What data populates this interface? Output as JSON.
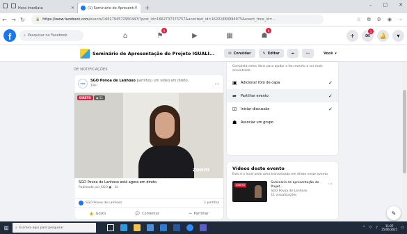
{
  "browser": {
    "tabs": [
      {
        "title": "Hora imediata"
      },
      {
        "title": "(1) Seminário de Apresentação"
      }
    ],
    "url_host": "https://www.facebook.com",
    "url_path": "/events/1661794572950447/?post_id=1662737373757&acontext_id=16201880994975&event_time_id=..."
  },
  "fb": {
    "search_placeholder": "Pesquisar no Facebook",
    "nav_badges": {
      "groups": "9",
      "marketplace": "9"
    },
    "right_badge": "1"
  },
  "page_header": {
    "title": "Seminário de Apresentação do Projeto IGUALI...",
    "buttons": {
      "share": "Convidar",
      "edit": "Editar"
    },
    "select_label": "Você"
  },
  "notifications": {
    "heading": "DE NOTIFICAÇÕES",
    "post": {
      "avatar_text": "SGO",
      "author": "SGO Povoa de Lanhoso",
      "action": "partilhou um vídeo em direto.",
      "time": "19h ·",
      "live_label": "DIRETO",
      "viewers": "11",
      "video_brand": "zoom",
      "body_line1": "SGO Povoa de Lanhoso está agora em direto.",
      "body_line2": "Publicado por SGO ● · 1h ·",
      "reactions": "SGO Povoa de Lanhoso",
      "shares": "1 partilha",
      "actions": {
        "like": "Gosto",
        "comment": "Comentar",
        "share": "Partilhar"
      }
    }
  },
  "checklist": {
    "intro": "Completa estes itens para ajudar o teu evento a ser mais encontrado.",
    "items": [
      {
        "label": "Adicionar foto de capa",
        "done": "✓"
      },
      {
        "label": "Partilhar evento",
        "done": "✓"
      },
      {
        "label": "Iniciar discussão",
        "done": "✓"
      },
      {
        "label": "Associar um grupo",
        "done": ""
      }
    ]
  },
  "videos": {
    "heading": "Vídeos deste evento",
    "desc": "Este é o local onde uma transmissão em direto neste evento.",
    "item": {
      "live": "DIRETO",
      "title": "Seminário de apresentação do Projet...",
      "sub": "SGO Povoa de Lanhoso",
      "views": "11 visualizações"
    }
  },
  "taskbar": {
    "search_placeholder": "Escreva aqui para pesquisar",
    "time": "11:07",
    "date": "25/06/2021"
  }
}
